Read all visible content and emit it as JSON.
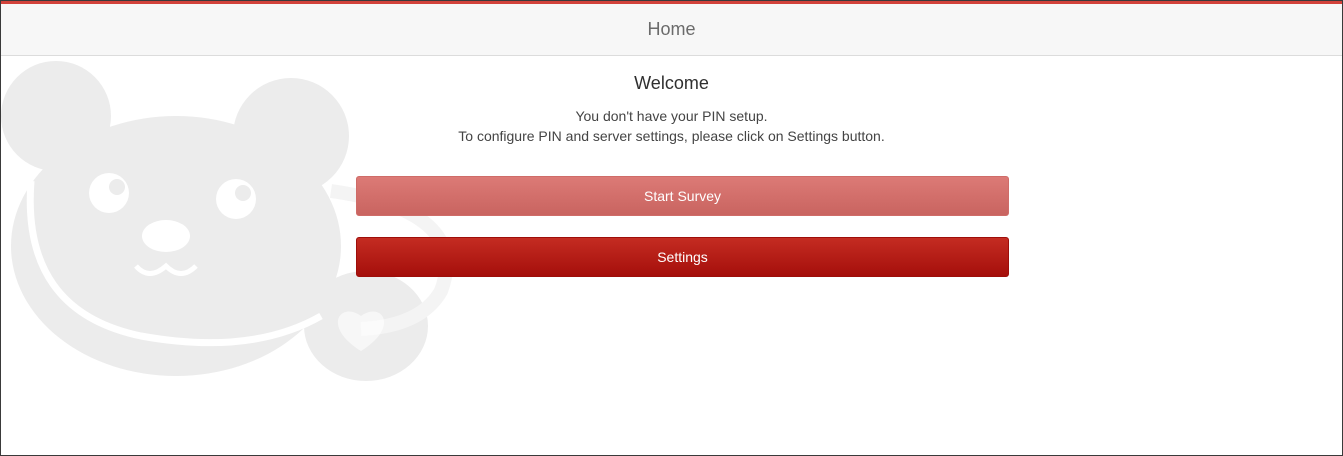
{
  "header": {
    "title": "Home"
  },
  "main": {
    "welcome_title": "Welcome",
    "message_line1": "You don't have your PIN setup.",
    "message_line2": "To configure PIN and server settings, please click on Settings button.",
    "start_survey_label": "Start Survey",
    "settings_label": "Settings"
  },
  "colors": {
    "accent": "#d2423a",
    "start_survey_button": "#d06d69",
    "settings_button": "#b81b14"
  },
  "icons": {
    "mascot": "bear-mascot-watermark"
  }
}
